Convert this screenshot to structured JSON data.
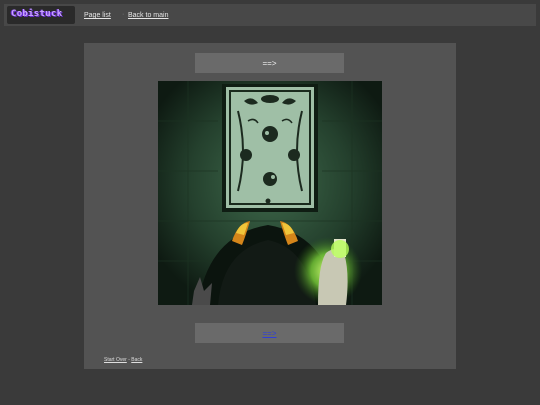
{
  "header": {
    "logo_text": "Cobistuck",
    "page_list_label": "Page list",
    "back_to_main_label": "Back to main"
  },
  "content": {
    "command_top": "==>",
    "command_bottom": "==>"
  },
  "footer": {
    "start_over_label": "Start Over",
    "separator": "-",
    "back_label": "Back"
  }
}
